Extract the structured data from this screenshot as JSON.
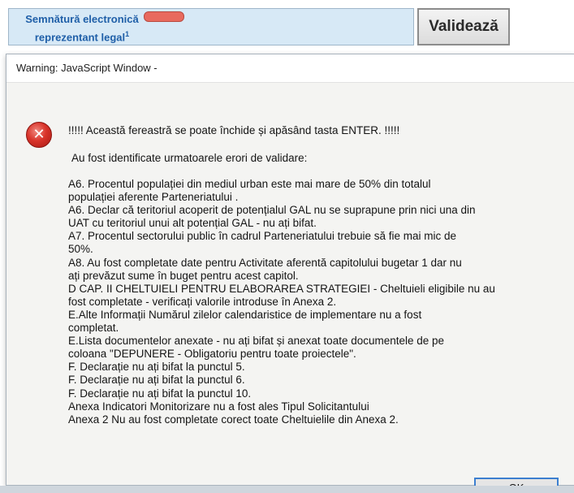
{
  "form": {
    "signature_label_line1": "Semnătură electronică",
    "signature_label_line2": "reprezentant legal",
    "signature_superscript": "1",
    "validate_button": "Validează"
  },
  "dialog": {
    "title": "Warning: JavaScript Window -",
    "heading": "!!!!! Această fereastră se poate închide și apăsând tasta ENTER. !!!!!",
    "subheading": "Au fost identificate urmatoarele erori de validare:",
    "errors": [
      "A6. Procentul populației din mediul urban este mai mare de 50% din totalul",
      "populației aferente Parteneriatului .",
      "A6. Declar că teritoriul acoperit de potențialul GAL nu se suprapune prin nici una din",
      "UAT cu teritoriul unui alt potențial GAL - nu ați bifat.",
      "A7. Procentul sectorului public în cadrul Parteneriatului trebuie să fie mai mic de",
      "50%.",
      "A8. Au fost completate date pentru Activitate aferentă capitolului bugetar 1 dar nu",
      "ați prevăzut sume în buget pentru acest capitol.",
      "D CAP. II CHELTUIELI PENTRU ELABORAREA STRATEGIEI  - Cheltuieli eligibile nu au",
      "fost completate - verificați valorile introduse în Anexa 2.",
      "E.Alte Informații Numărul zilelor calendaristice de implementare nu a fost",
      "completat.",
      "E.Lista documentelor anexate - nu ați bifat și anexat toate documentele de pe",
      "coloana \"DEPUNERE - Obligatoriu pentru toate proiectele\".",
      "F. Declarație nu ați bifat la punctul 5.",
      "F. Declarație nu ați bifat la punctul 6.",
      "F. Declarație nu ați bifat la punctul 10.",
      "Anexa Indicatori Monitorizare nu a fost ales Tipul Solicitantului",
      "Anexa 2 Nu au fost completate corect toate Cheltuielile din Anexa 2."
    ],
    "ok_button": "OK",
    "icon": "error-icon"
  },
  "colors": {
    "signature_box": "#d7e9f6",
    "signature_text": "#1f5fa8",
    "error_red": "#d9342b",
    "ok_border": "#3c7fd0"
  }
}
